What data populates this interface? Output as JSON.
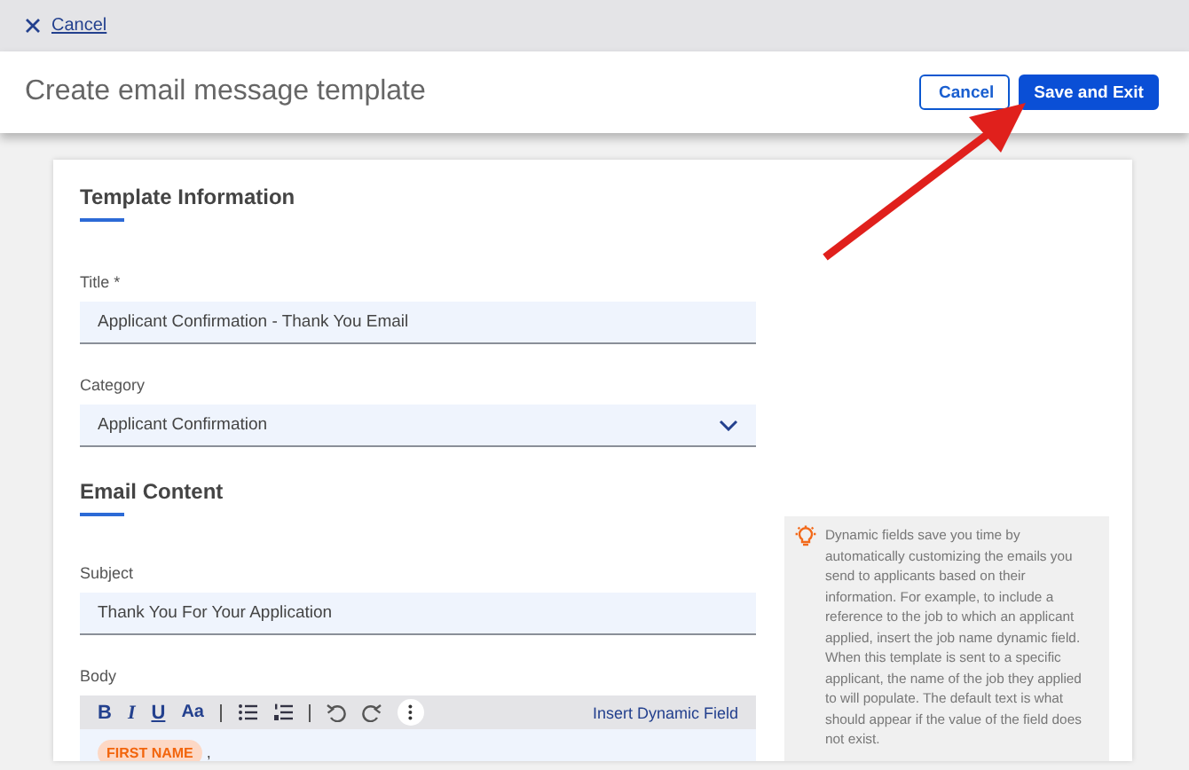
{
  "top_bar": {
    "cancel_link": "Cancel"
  },
  "header": {
    "title": "Create email message template",
    "buttons": [
      {
        "label": "Cancel",
        "kind": "secondary"
      },
      {
        "label": "Save and Exit",
        "kind": "primary"
      }
    ]
  },
  "sections": [
    {
      "title": "Template Information",
      "fields": [
        {
          "label": "Title *",
          "value": "Applicant Confirmation - Thank You Email",
          "kind": "text"
        },
        {
          "label": "Category",
          "value": "Applicant Confirmation",
          "kind": "select"
        }
      ]
    },
    {
      "title": "Email Content",
      "fields": [
        {
          "label": "Subject",
          "value": "Thank You For Your Application",
          "kind": "text"
        }
      ]
    }
  ],
  "body": {
    "label": "Body",
    "toolbar": [
      {
        "kind": "bold",
        "label": "B"
      },
      {
        "kind": "italic",
        "label": "I"
      },
      {
        "kind": "underline",
        "label": "U"
      },
      {
        "kind": "font",
        "label": "Aa"
      },
      {
        "kind": "separator"
      },
      {
        "kind": "bullets"
      },
      {
        "kind": "numbered"
      },
      {
        "kind": "separator"
      },
      {
        "kind": "undo"
      },
      {
        "kind": "redo"
      },
      {
        "kind": "more"
      }
    ],
    "insert_link": "Insert Dynamic Field",
    "chip": "FIRST NAME",
    "text_after": ","
  },
  "tip": {
    "text": "Dynamic fields save you time by automatically customizing the emails you send to applicants based on their information. For example, to include a reference to the job to which an applicant applied, insert the job name dynamic field. When this template is sent to a specific applicant, the name of the job they applied to will populate. The default text is what should appear if the value of the field does not exist."
  }
}
